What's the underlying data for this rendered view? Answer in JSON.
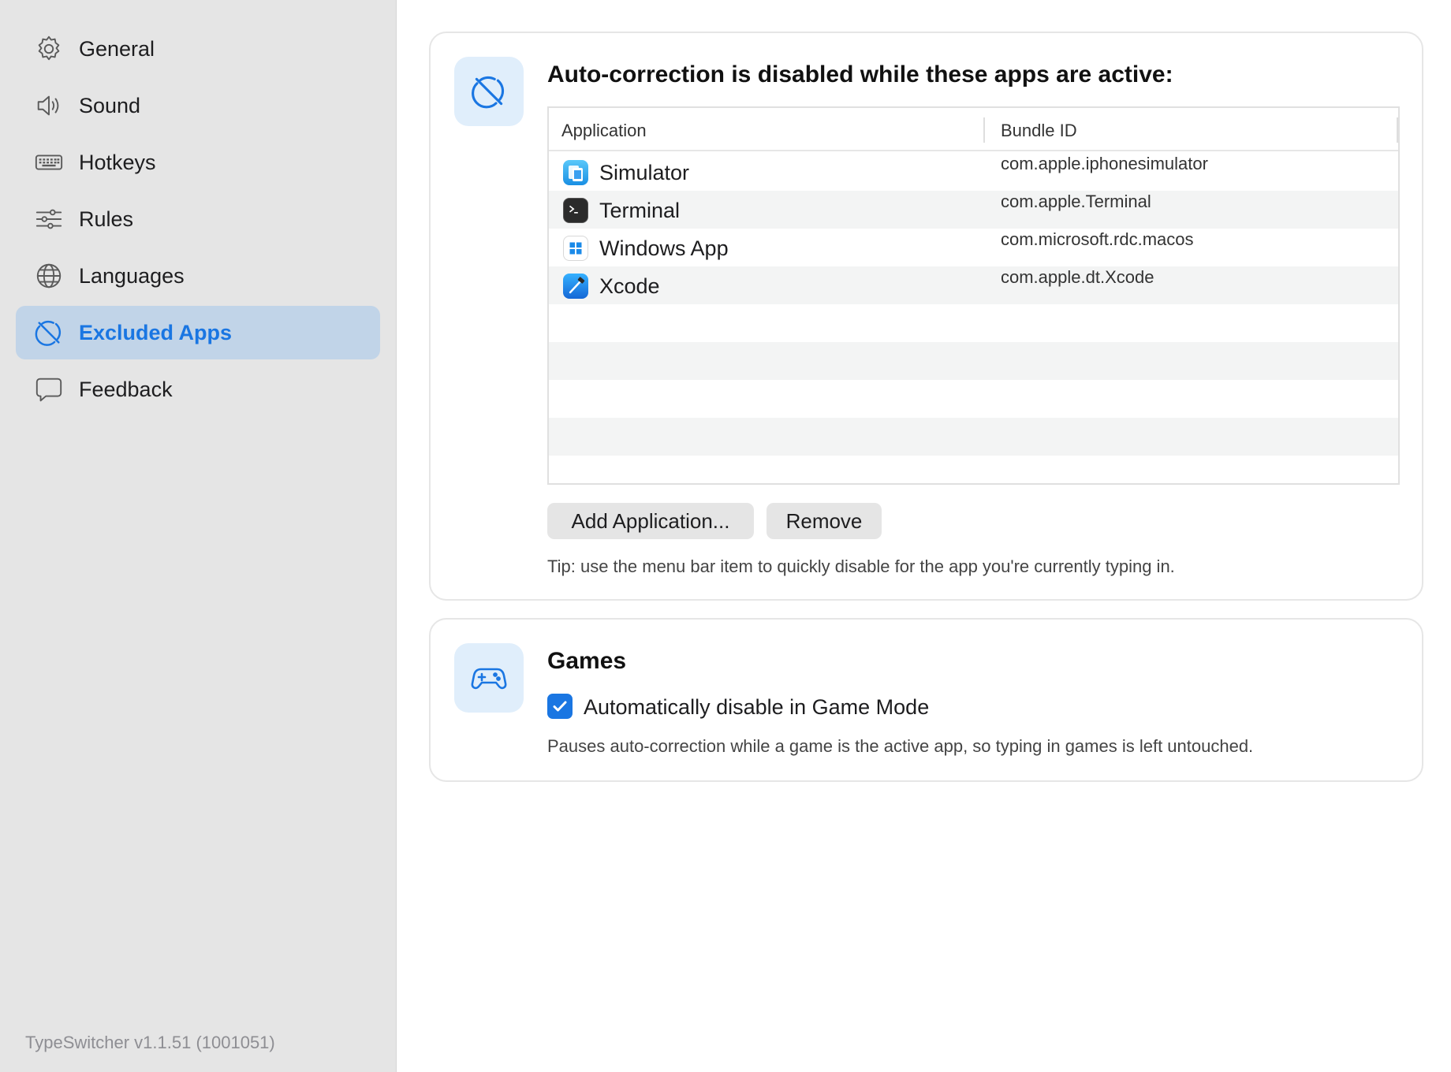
{
  "sidebar": {
    "items": [
      {
        "label": "General",
        "icon": "gear-icon",
        "selected": false
      },
      {
        "label": "Sound",
        "icon": "speaker-icon",
        "selected": false
      },
      {
        "label": "Hotkeys",
        "icon": "keyboard-icon",
        "selected": false
      },
      {
        "label": "Rules",
        "icon": "sliders-icon",
        "selected": false
      },
      {
        "label": "Languages",
        "icon": "globe-icon",
        "selected": false
      },
      {
        "label": "Excluded Apps",
        "icon": "disabled-circle-icon",
        "selected": true
      },
      {
        "label": "Feedback",
        "icon": "speech-bubble-icon",
        "selected": false
      }
    ],
    "version": "TypeSwitcher v1.1.51 (1001051)"
  },
  "excluded": {
    "icon": "disabled-circle-icon",
    "title": "Auto-correction is disabled while these apps are active:",
    "table": {
      "columns": [
        "Application",
        "Bundle ID"
      ],
      "rows": [
        {
          "name": "Simulator",
          "bundle_id": "com.apple.iphonesimulator",
          "icon": "simulator-icon"
        },
        {
          "name": "Terminal",
          "bundle_id": "com.apple.Terminal",
          "icon": "terminal-icon"
        },
        {
          "name": "Windows App",
          "bundle_id": "com.microsoft.rdc.macos",
          "icon": "windows-app-icon"
        },
        {
          "name": "Xcode",
          "bundle_id": "com.apple.dt.Xcode",
          "icon": "xcode-icon"
        }
      ]
    },
    "add_button": "Add Application...",
    "remove_button": "Remove",
    "tip": "Tip: use the menu bar item to quickly disable for the app you're currently typing in."
  },
  "games": {
    "icon": "gamepad-icon",
    "title": "Games",
    "checkbox_label": "Automatically disable in Game Mode",
    "checked": true,
    "description": "Pauses auto-correction while a game is the active app, so typing in games is left untouched."
  },
  "colors": {
    "accent": "#1a76e2",
    "sidebar_bg": "#e5e5e5",
    "selected_bg": "#c1d4e8",
    "icon_tile_bg": "#e0eefb"
  }
}
